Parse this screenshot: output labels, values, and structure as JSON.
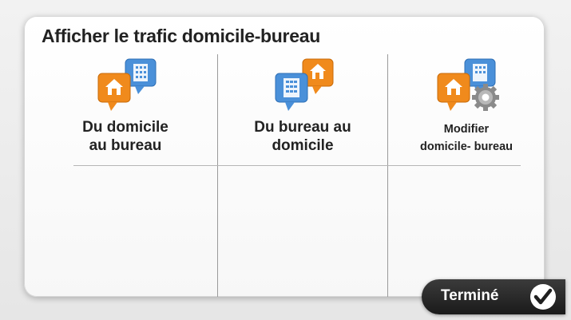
{
  "screen": {
    "title": "Afficher le trafic domicile-bureau"
  },
  "options": [
    {
      "line1": "Du domicile",
      "line2": "au bureau",
      "icon": "home-to-office-icon"
    },
    {
      "line1": "Du bureau au",
      "line2": "domicile",
      "icon": "office-to-home-icon"
    },
    {
      "line1": "Modifier",
      "line2": "domicile- bureau",
      "icon": "edit-home-office-icon"
    }
  ],
  "footer": {
    "done_label": "Terminé",
    "done_icon": "checkmark-icon"
  },
  "colors": {
    "home_pin": "#f08a1c",
    "office_pin": "#4a90d9",
    "button_dark": "#262626"
  }
}
